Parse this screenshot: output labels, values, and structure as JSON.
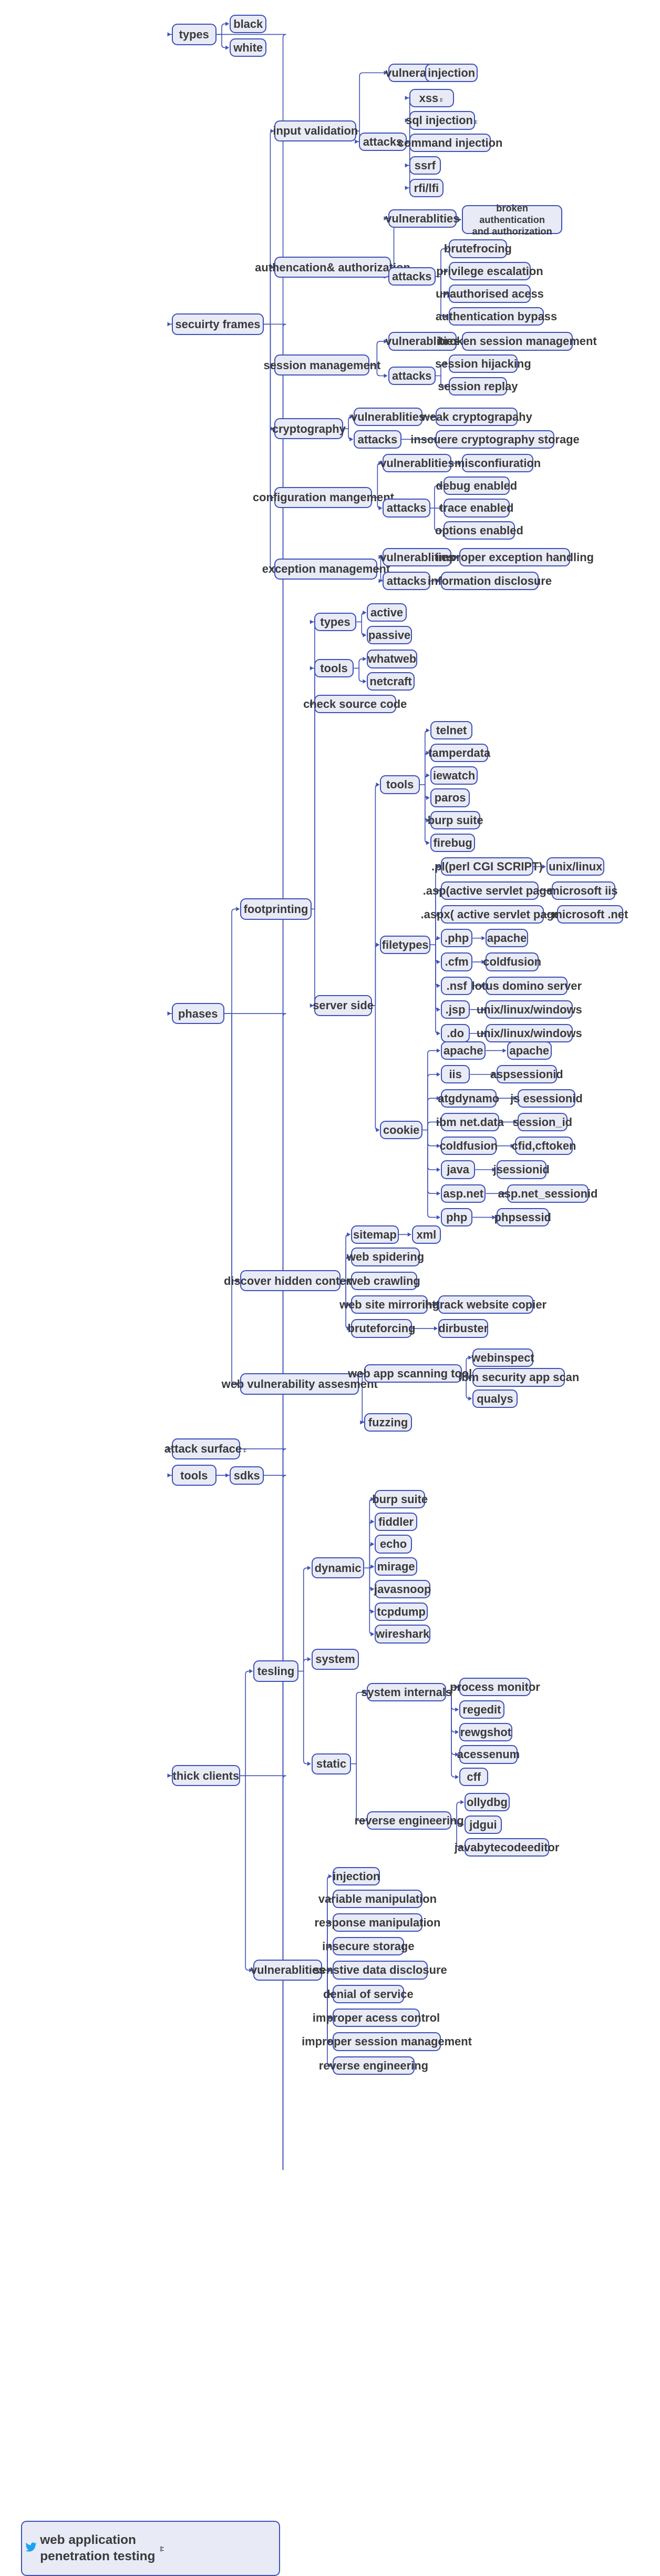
{
  "diagram": {
    "title": "web application\npenetration testing",
    "type": "mindmap",
    "accent_color": "#3f51b5",
    "node_fill": "#e8eaf6",
    "text_color": "#3a3a3a",
    "root_icon": "twitter-bird-icon",
    "root_badge_icon": "collapse-node-icon"
  },
  "nodes": {
    "root": "web application\npenetration testing",
    "types": "types",
    "types_black": "black",
    "types_white": "white",
    "security_frames": "secuirty frames",
    "input_validation": "input validation",
    "iv_vuln": "vulnerablities",
    "iv_vuln_injection": "injection",
    "iv_attacks": "attacks",
    "iv_xss": "xss",
    "iv_sqli": "sql injection",
    "iv_cmdinj": "command injection",
    "iv_ssrf": "ssrf",
    "iv_rfilfi": "rfi/lfi",
    "auth": "authencation& authorization",
    "auth_vuln": "vulnerablities",
    "auth_broken": "broken authentication\nand authorization",
    "auth_attacks": "attacks",
    "auth_brute": "brutefrocing",
    "auth_privesc": "privilege escalation",
    "auth_unauth": "unauthorised acess",
    "auth_bypass": "authentication bypass",
    "session_mgmt": "session management",
    "sm_vuln": "vulnerablities",
    "sm_broken": "broken session management",
    "sm_attacks": "attacks",
    "sm_hijack": "session hijacking",
    "sm_replay": "session replay",
    "crypto": "cryptography",
    "crypto_vuln": "vulnerablities",
    "crypto_weak": "weak cryptograpahy",
    "crypto_attacks": "attacks",
    "crypto_insecure": "inscuere cryptography storage",
    "config_mgmt": "configuration mangement",
    "cm_vuln": "vulnerablities",
    "cm_misconfig": "misconfiuration",
    "cm_attacks": "attacks",
    "cm_debug": "debug enabled",
    "cm_trace": "trace enabled",
    "cm_options": "options enabled",
    "exception_mgmt": "exception management",
    "em_vuln": "vulnerablities",
    "em_improper": "improper exception handling",
    "em_attacks": "attacks",
    "em_infodisc": "information disclosure",
    "phases": "phases",
    "footprinting": "footprinting",
    "fp_types": "types",
    "fp_active": "active",
    "fp_passive": "passive",
    "fp_tools": "tools",
    "fp_whatweb": "whatweb",
    "fp_netcraft": "netcraft",
    "fp_check_source": "check source code",
    "server_side": "server side",
    "ss_tools": "tools",
    "ss_telnet": "telnet",
    "ss_tamperdata": "tamperdata",
    "ss_iewatch": "iewatch",
    "ss_paros": "paros",
    "ss_burp": "burp suite",
    "ss_firebug": "firebug",
    "filetypes": "filetypes",
    "ft_pl": ".pl(perl CGI SCRIPT)",
    "ft_pl_os": "unix/linux",
    "ft_asp": ".asp(active servlet page)",
    "ft_asp_os": "microsoft iis",
    "ft_aspx": ".aspx( active servlet page)",
    "ft_aspx_os": "microsoft .net",
    "ft_php": ".php",
    "ft_php_os": "apache",
    "ft_cfm": ".cfm",
    "ft_cfm_os": "coldfusion",
    "ft_nsf": ".nsf",
    "ft_nsf_os": "lotus domino server",
    "ft_jsp": ".jsp",
    "ft_jsp_os": "unix/linux/windows",
    "ft_do": ".do",
    "ft_do_os": "unix/linux/windows",
    "cookie": "cookie",
    "ck_apache": "apache",
    "ck_apache_v": "apache",
    "ck_iis": "iis",
    "ck_iis_v": "aspsessionid",
    "ck_atg": "atgdynamo",
    "ck_atg_v": "js esessionid",
    "ck_ibm": "ibm net.data",
    "ck_ibm_v": "session_id",
    "ck_cf": "coldfusion",
    "ck_cf_v": "cfid,cftoken",
    "ck_java": "java",
    "ck_java_v": "jsessionid",
    "ck_aspnet": "asp.net",
    "ck_aspnet_v": "asp.net_sessionid",
    "ck_php": "php",
    "ck_php_v": "phpsessid",
    "discover_hidden": "discover hidden content",
    "dh_sitemap": "sitemap",
    "dh_xml": "xml",
    "dh_spidering": "web spidering",
    "dh_crawling": "web crawling",
    "dh_mirroring": "web site mirroring",
    "dh_httrack": "httrack website copier",
    "dh_bruteforcing": "bruteforcing",
    "dh_dirbuster": "dirbuster",
    "web_vuln_assess": "web vulnerability assesment",
    "wva_tools": "web app scanning tools",
    "wva_webinspect": "webinspect",
    "wva_ibm": "ibm security app scan",
    "wva_qualys": "qualys",
    "wva_fuzzing": "fuzzing",
    "attack_surface": "attack surface",
    "tools": "tools",
    "tools_sdks": "sdks",
    "thick_clients": "thick clients",
    "testing": "tesling",
    "dynamic": "dynamic",
    "dy_burp": "burp suite",
    "dy_fiddler": "fiddler",
    "dy_echo": "echo",
    "dy_mirage": "mirage",
    "dy_javasnoop": "javasnoop",
    "dy_tcpdump": "tcpdump",
    "dy_wireshark": "wireshark",
    "system": "system",
    "static": "static",
    "sys_internals": "system internals",
    "si_procmon": "process monitor",
    "si_regedit": "regedit",
    "si_rewgshot": "rewgshot",
    "si_acessenum": "acessenum",
    "si_cff": "cff",
    "reverse_eng": "reverse engineering",
    "re_ollydbg": "ollydbg",
    "re_jdgui": "jdgui",
    "re_javabyte": "javabytecodeeditor",
    "tc_vuln": "vulnerablities",
    "tv_injection": "injection",
    "tv_variable": "variable  manipulation",
    "tv_response": "response manipulation",
    "tv_insecure": "insecure storage",
    "tv_senstive": "senstive data disclosure",
    "tv_dos": "denial of service",
    "tv_improper_access": "improper acess control",
    "tv_improper_session": "improper session management",
    "tv_reverse": "reverse engineering"
  }
}
